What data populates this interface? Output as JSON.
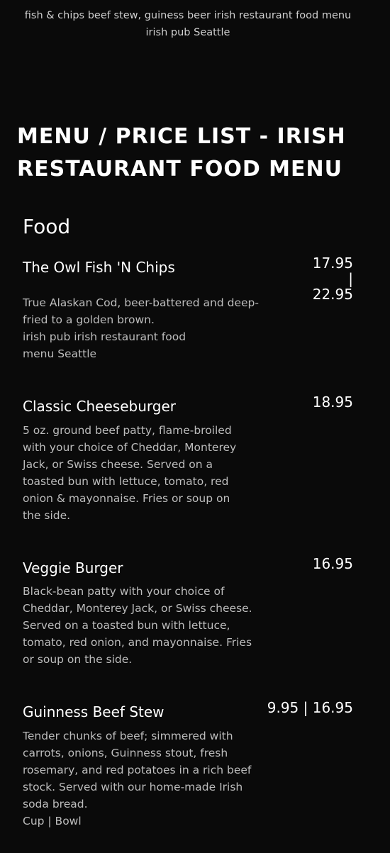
{
  "caption": "fish & chips beef stew, guiness beer irish restaurant food menu irish pub Seattle",
  "heading": "MENU / PRICE LIST - IRISH RESTAURANT FOOD MENU",
  "section": "Food",
  "items": [
    {
      "name": "The Owl Fish 'N Chips",
      "price": "17.95 | 22.95",
      "desc": [
        "True Alaskan Cod, beer-battered and deep-fried to a golden brown.",
        "irish pub irish restaurant food menu Seattle"
      ]
    },
    {
      "name": "Classic Cheeseburger",
      "price": "18.95",
      "desc": [
        "5 oz. ground beef patty, flame-broiled with your choice of Cheddar, Monterey Jack, or Swiss cheese.  Served on a toasted bun with lettuce, tomato, red onion & mayonnaise.  Fries or soup on the side."
      ]
    },
    {
      "name": "Veggie Burger",
      "price": "16.95",
      "desc": [
        "Black-bean patty with your choice of Cheddar, Monterey Jack, or Swiss cheese. Served on a toasted bun with lettuce, tomato, red onion, and mayonnaise. Fries or soup on the side."
      ]
    },
    {
      "name": "Guinness Beef Stew",
      "price": "9.95 | 16.95",
      "desc": [
        "Tender chunks of beef; simmered with carrots, onions, Guinness stout, fresh rosemary, and red potatoes in a rich beef stock.  Served with our home-made Irish soda bread.",
        "Cup | Bowl"
      ]
    }
  ]
}
